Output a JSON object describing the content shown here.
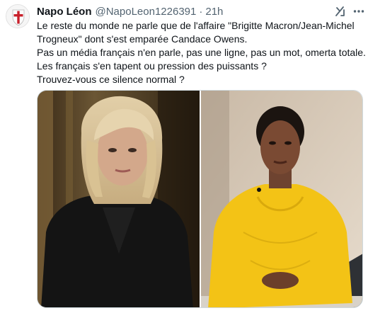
{
  "tweet": {
    "author_name": "Napo Léon",
    "handle": "@NapoLeon1226391",
    "separator": "·",
    "time": "21h",
    "text_lines": [
      "Le reste du monde ne parle que de l'affaire \"Brigitte Macron/Jean-Michel",
      "Trogneux\" dont s'est emparée Candace Owens.",
      "Pas un média français n'en parle, pas une ligne, pas un mot, omerta totale.",
      "Les français s'en tapent ou pression des puissants ?",
      "Trouvez-vous ce silence normal ?"
    ]
  },
  "icons": {
    "avatar": "crusader-shield-icon",
    "grok": "grok-icon",
    "more": "more-dots-icon"
  },
  "media": {
    "count": 2
  },
  "colors": {
    "text": "#0f1419",
    "secondary": "#536471",
    "border": "#cfd9de",
    "shield_red": "#c8202b",
    "sweater_yellow": "#f3c316"
  }
}
